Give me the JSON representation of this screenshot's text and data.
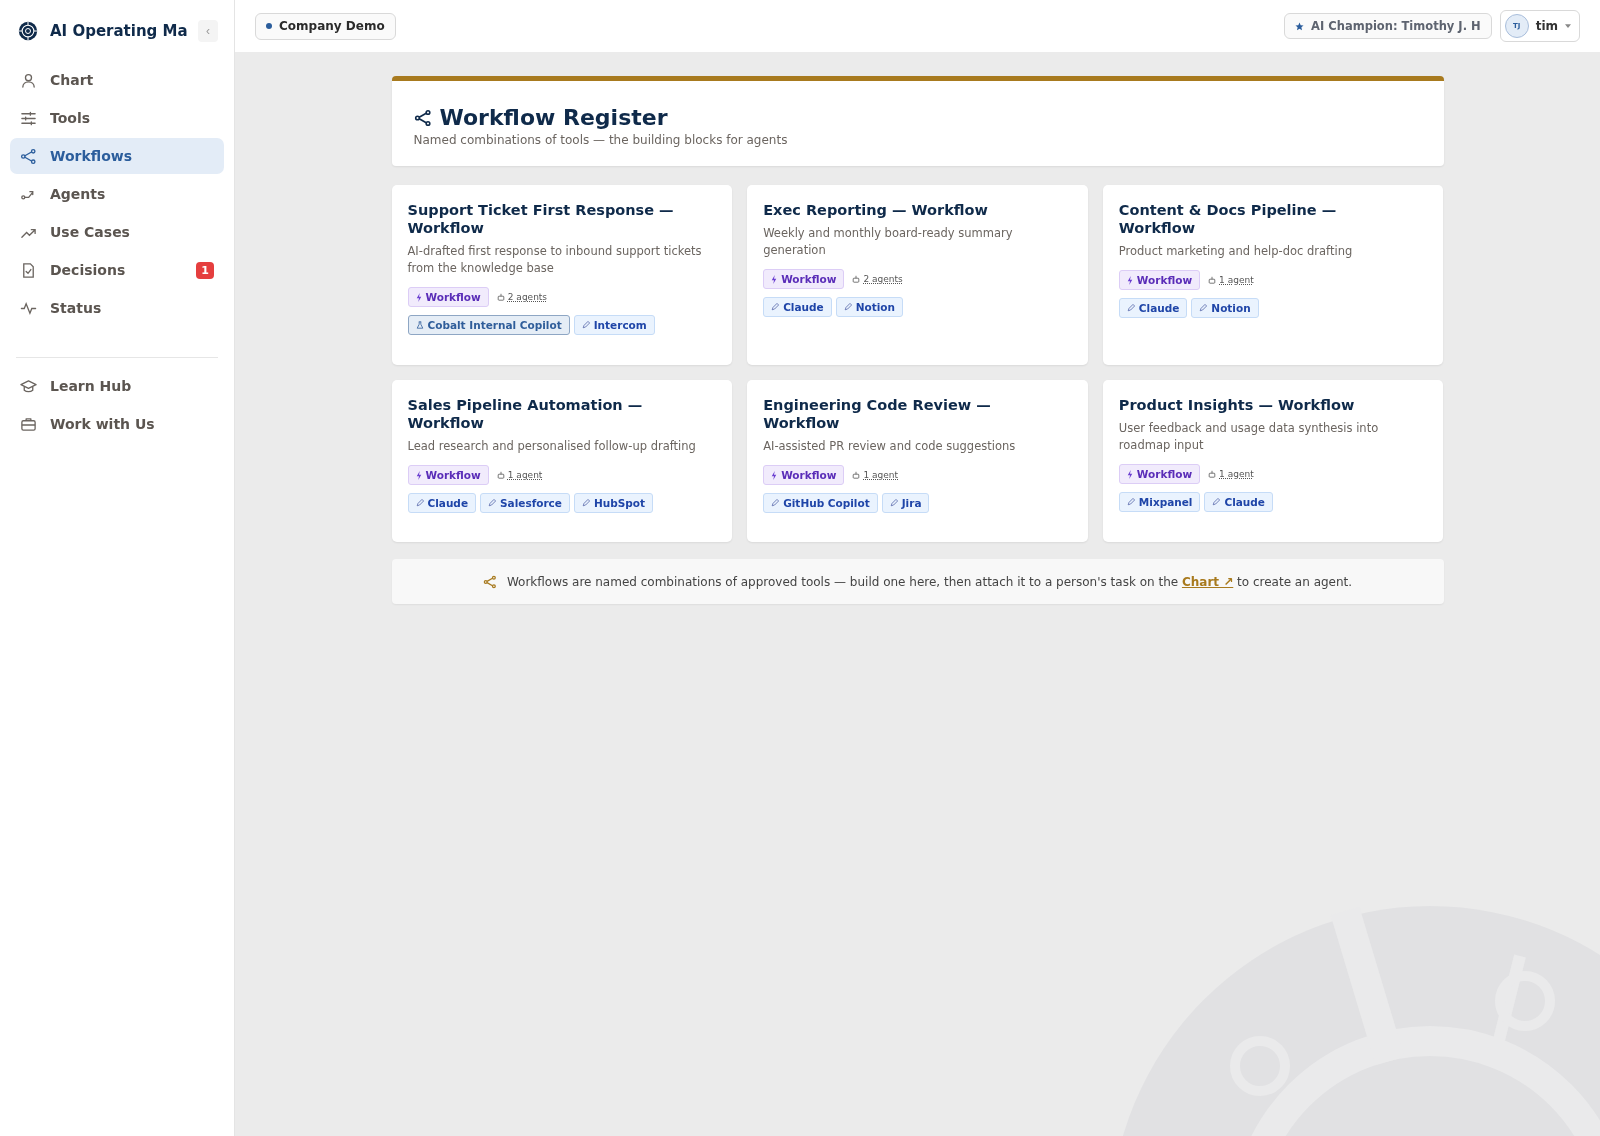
{
  "sidebar": {
    "app_title": "AI Operating Ma",
    "collapse_label": "‹",
    "items": [
      {
        "label": "Chart",
        "selected": false
      },
      {
        "label": "Tools",
        "selected": false
      },
      {
        "label": "Workflows",
        "selected": true
      },
      {
        "label": "Agents",
        "selected": false
      },
      {
        "label": "Use Cases",
        "selected": false
      },
      {
        "label": "Decisions",
        "selected": false,
        "badge": "1"
      },
      {
        "label": "Status",
        "selected": false
      }
    ],
    "secondary_items": [
      {
        "label": "Learn Hub",
        "selected": false
      },
      {
        "label": "Work with Us",
        "selected": false
      }
    ]
  },
  "topbar": {
    "workspace": "Company Demo",
    "champion": "AI Champion: Timothy J. H",
    "user_initials": "TJ",
    "user_name": "tim"
  },
  "header": {
    "title": "Workflow Register",
    "subtitle": "Named combinations of tools — the building blocks for agents"
  },
  "workflows": [
    {
      "title": "Support Ticket First Response — Workflow",
      "description": "AI-drafted first response to inbound support tickets from the knowledge base",
      "type_tag": "Workflow",
      "agents": "2 agents",
      "tools": [
        {
          "label": "Cobalt Internal Copilot",
          "kind": "internal"
        },
        {
          "label": "Intercom",
          "kind": "tool"
        }
      ]
    },
    {
      "title": "Exec Reporting — Workflow",
      "description": "Weekly and monthly board-ready summary generation",
      "type_tag": "Workflow",
      "agents": "2 agents",
      "tools": [
        {
          "label": "Claude",
          "kind": "tool"
        },
        {
          "label": "Notion",
          "kind": "tool"
        }
      ]
    },
    {
      "title": "Content & Docs Pipeline — Workflow",
      "description": "Product marketing and help-doc drafting",
      "type_tag": "Workflow",
      "agents": "1 agent",
      "tools": [
        {
          "label": "Claude",
          "kind": "tool"
        },
        {
          "label": "Notion",
          "kind": "tool"
        }
      ]
    },
    {
      "title": "Sales Pipeline Automation — Workflow",
      "description": "Lead research and personalised follow-up drafting",
      "type_tag": "Workflow",
      "agents": "1 agent",
      "tools": [
        {
          "label": "Claude",
          "kind": "tool"
        },
        {
          "label": "Salesforce",
          "kind": "tool"
        },
        {
          "label": "HubSpot",
          "kind": "tool"
        }
      ]
    },
    {
      "title": "Engineering Code Review — Workflow",
      "description": "AI-assisted PR review and code suggestions",
      "type_tag": "Workflow",
      "agents": "1 agent",
      "tools": [
        {
          "label": "GitHub Copilot",
          "kind": "tool"
        },
        {
          "label": "Jira",
          "kind": "tool"
        }
      ]
    },
    {
      "title": "Product Insights — Workflow",
      "description": "User feedback and usage data synthesis into roadmap input",
      "type_tag": "Workflow",
      "agents": "1 agent",
      "tools": [
        {
          "label": "Mixpanel",
          "kind": "tool"
        },
        {
          "label": "Claude",
          "kind": "tool"
        }
      ]
    }
  ],
  "footer_note": {
    "before": "Workflows are named combinations of approved tools — build one here, then attach it to a person's task on the",
    "link": "Chart ↗",
    "after": "to create an agent."
  }
}
